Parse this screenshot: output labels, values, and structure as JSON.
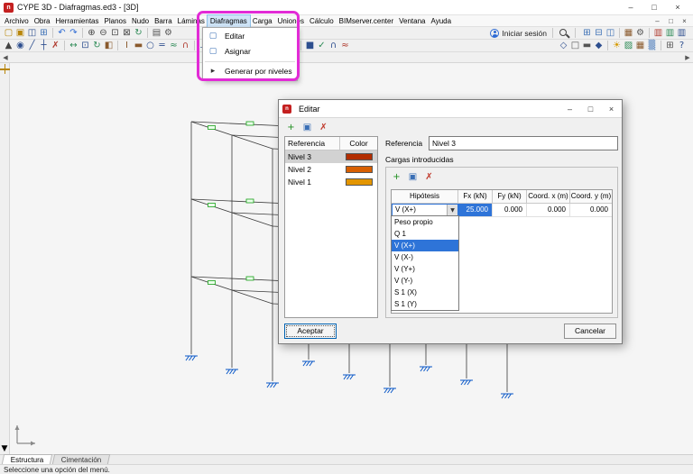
{
  "window": {
    "title": "CYPE 3D - Diafragmas.ed3 - [3D]",
    "app_icon": "n",
    "controls": {
      "minimize": "–",
      "maximize": "□",
      "close": "×"
    },
    "mdi_controls": {
      "minimize": "–",
      "restore": "□",
      "close": "×"
    }
  },
  "menubar": {
    "items": [
      {
        "label": "Archivo"
      },
      {
        "label": "Obra"
      },
      {
        "label": "Herramientas"
      },
      {
        "label": "Planos"
      },
      {
        "label": "Nudo"
      },
      {
        "label": "Barra"
      },
      {
        "label": "Láminas"
      },
      {
        "label": "Diafragmas",
        "active": true
      },
      {
        "label": "Carga"
      },
      {
        "label": "Uniones"
      },
      {
        "label": "Cálculo"
      },
      {
        "label": "BIMserver.center"
      },
      {
        "label": "Ventana"
      },
      {
        "label": "Ayuda"
      }
    ]
  },
  "diafragmas_menu": {
    "items": [
      {
        "label": "Editar",
        "icon": "▢"
      },
      {
        "label": "Asignar",
        "icon": "▢"
      },
      {
        "label": "Generar por niveles",
        "icon": "▸"
      }
    ]
  },
  "toolbar1_left": [
    {
      "name": "new-job",
      "glyph": "▢",
      "color": "#b8860b"
    },
    {
      "name": "open-job",
      "glyph": "▣",
      "color": "#b8860b"
    },
    {
      "name": "save-job",
      "glyph": "◫",
      "color": "#2e4f8f"
    },
    {
      "name": "job-manager",
      "glyph": "⊞",
      "color": "#3a6fb5"
    },
    {
      "sep": true
    },
    {
      "name": "undo",
      "glyph": "↶",
      "color": "#2e6bd4"
    },
    {
      "name": "redo",
      "glyph": "↷",
      "color": "#2e6bd4"
    },
    {
      "sep": true
    },
    {
      "name": "zoom-in",
      "glyph": "⊕",
      "color": "#444444"
    },
    {
      "name": "zoom-out",
      "glyph": "⊖",
      "color": "#444444"
    },
    {
      "name": "zoom-window",
      "glyph": "⊡",
      "color": "#444444"
    },
    {
      "name": "zoom-extents",
      "glyph": "⊠",
      "color": "#444444"
    },
    {
      "name": "redraw",
      "glyph": "↻",
      "color": "#2e8b57"
    },
    {
      "sep": true
    },
    {
      "name": "print",
      "glyph": "▤",
      "color": "#555555"
    },
    {
      "name": "options",
      "glyph": "⚙",
      "color": "#555555"
    }
  ],
  "toolbar1_right": [
    {
      "name": "window-tile",
      "glyph": "⊞",
      "color": "#3a6fb5"
    },
    {
      "name": "window-cascade",
      "glyph": "⊟",
      "color": "#3a6fb5"
    },
    {
      "name": "window-views",
      "glyph": "◫",
      "color": "#3a6fb5"
    },
    {
      "sep": true
    },
    {
      "name": "color-palette",
      "glyph": "▦",
      "color": "#8a5a2d"
    },
    {
      "name": "display-options",
      "glyph": "⚙",
      "color": "#555555"
    },
    {
      "sep": true
    },
    {
      "name": "report-red",
      "glyph": "▥",
      "color": "#b03a2e"
    },
    {
      "name": "report-green",
      "glyph": "▥",
      "color": "#2e8b57"
    },
    {
      "name": "report-blue",
      "glyph": "▥",
      "color": "#2e4f8f"
    }
  ],
  "toolbar2_main": [
    {
      "name": "select",
      "glyph": "▲",
      "color": "#444444"
    },
    {
      "name": "new-node",
      "glyph": "◉",
      "color": "#2e4f8f"
    },
    {
      "name": "new-bar",
      "glyph": "╱",
      "color": "#2e4f8f"
    },
    {
      "name": "intermediate-node",
      "glyph": "┼",
      "color": "#2e4f8f"
    },
    {
      "name": "delete",
      "glyph": "✗",
      "color": "#b03a2e"
    },
    {
      "sep": true
    },
    {
      "name": "move",
      "glyph": "↔",
      "color": "#2e8b57"
    },
    {
      "name": "copy",
      "glyph": "⊡",
      "color": "#2e4f8f"
    },
    {
      "name": "rotate",
      "glyph": "↻",
      "color": "#2e8b57"
    },
    {
      "name": "mirror",
      "glyph": "◧",
      "color": "#8a5a2d"
    },
    {
      "sep": true
    },
    {
      "name": "describe-profile",
      "glyph": "I",
      "color": "#8a5a2d"
    },
    {
      "name": "describe-material",
      "glyph": "▬",
      "color": "#8a5a2d"
    },
    {
      "name": "bar-hinge",
      "glyph": "○",
      "color": "#2e4f8f"
    },
    {
      "name": "bar-tie",
      "glyph": "═",
      "color": "#2e4f8f"
    },
    {
      "name": "buckling",
      "glyph": "≈",
      "color": "#2e8b57"
    },
    {
      "name": "deflection-limit",
      "glyph": "∩",
      "color": "#b03a2e"
    },
    {
      "sep": true
    },
    {
      "name": "support",
      "glyph": "⊥",
      "color": "#2e4f8f"
    },
    {
      "name": "point-load",
      "glyph": "↓",
      "color": "#b03a2e"
    },
    {
      "name": "linear-load",
      "glyph": "⇓",
      "color": "#b03a2e"
    },
    {
      "name": "load-hypothesis",
      "glyph": "∑",
      "color": "#555555"
    },
    {
      "name": "combinations",
      "glyph": "≡",
      "color": "#555555"
    },
    {
      "sep": true
    },
    {
      "name": "diaphragm-edit",
      "glyph": "▬",
      "color": "#2e8b57"
    },
    {
      "name": "diaphragm-assign",
      "glyph": "▦",
      "color": "#2e8b57"
    },
    {
      "name": "generate-levels",
      "glyph": "▤",
      "color": "#2e8b57"
    },
    {
      "sep": true
    },
    {
      "name": "calculate",
      "glyph": "■",
      "color": "#2e4f8f"
    },
    {
      "name": "check-bars",
      "glyph": "✓",
      "color": "#2e8b57"
    },
    {
      "name": "envelopes",
      "glyph": "∩",
      "color": "#2e4f8f"
    },
    {
      "name": "deformed-shape",
      "glyph": "≈",
      "color": "#b03a2e"
    }
  ],
  "toolbar2_right": [
    {
      "name": "view-3d",
      "glyph": "◇",
      "color": "#2e4f8f"
    },
    {
      "name": "view-front",
      "glyph": "□",
      "color": "#555555"
    },
    {
      "name": "view-top",
      "glyph": "▬",
      "color": "#555555"
    },
    {
      "name": "perspective",
      "glyph": "◆",
      "color": "#2e4f8f"
    },
    {
      "sep": true
    },
    {
      "name": "light",
      "glyph": "☀",
      "color": "#d69a00"
    },
    {
      "name": "render",
      "glyph": "▨",
      "color": "#2e8b57"
    },
    {
      "name": "textures",
      "glyph": "▦",
      "color": "#8a5a2d"
    },
    {
      "name": "background-color",
      "glyph": "▒",
      "color": "#3a6fb5"
    },
    {
      "sep": true
    },
    {
      "name": "full-screen",
      "glyph": "⊞",
      "color": "#555555"
    },
    {
      "name": "view-help",
      "glyph": "?",
      "color": "#2e4f8f"
    }
  ],
  "login": {
    "label": "Iniciar sesión"
  },
  "scroll": {
    "left": "◀",
    "right": "▶",
    "down": "▼"
  },
  "dialog": {
    "title": "Editar",
    "toolbar_icons": [
      {
        "name": "add-element",
        "glyph": "+",
        "color": "#1e8e1e"
      },
      {
        "name": "copy-element",
        "glyph": "▣",
        "color": "#3a6fb5"
      },
      {
        "name": "delete-element",
        "glyph": "✗",
        "color": "#c0392b"
      }
    ],
    "left_table": {
      "headers": [
        "Referencia",
        "Color"
      ],
      "rows": [
        {
          "referencia": "Nivel 3",
          "color": "#b22d00",
          "selected": true
        },
        {
          "referencia": "Nivel 2",
          "color": "#d85f00",
          "selected": false
        },
        {
          "referencia": "Nivel 1",
          "color": "#e39500",
          "selected": false
        }
      ]
    },
    "referencia_label": "Referencia",
    "referencia_value": "Nivel 3",
    "group_title": "Cargas introducidas",
    "loads_table": {
      "headers": [
        "Hipótesis",
        "Fx (kN)",
        "Fy (kN)",
        "Coord. x (m)",
        "Coord. y (m)"
      ],
      "row": {
        "hipotesis": "V (X+)",
        "fx": "25.000",
        "fy": "0.000",
        "coord_x": "0.000",
        "coord_y": "0.000"
      }
    },
    "combo_options": [
      "Peso propio",
      "Q 1",
      "V (X+)",
      "V (X-)",
      "V (Y+)",
      "V (Y-)",
      "S 1 (X)",
      "S 1 (Y)"
    ],
    "combo_selected": "V (X+)",
    "buttons": {
      "accept": "Aceptar",
      "cancel": "Cancelar"
    }
  },
  "tabs": [
    "Estructura",
    "Cimentación"
  ],
  "status_bar": "Seleccione una opción del menú.",
  "colors": {
    "selection_blue": "#2e74d8",
    "annotation_magenta": "#e22bd6",
    "support_blue": "#0a58c8",
    "tag_green": "#18a018",
    "app_red": "#c42020"
  }
}
